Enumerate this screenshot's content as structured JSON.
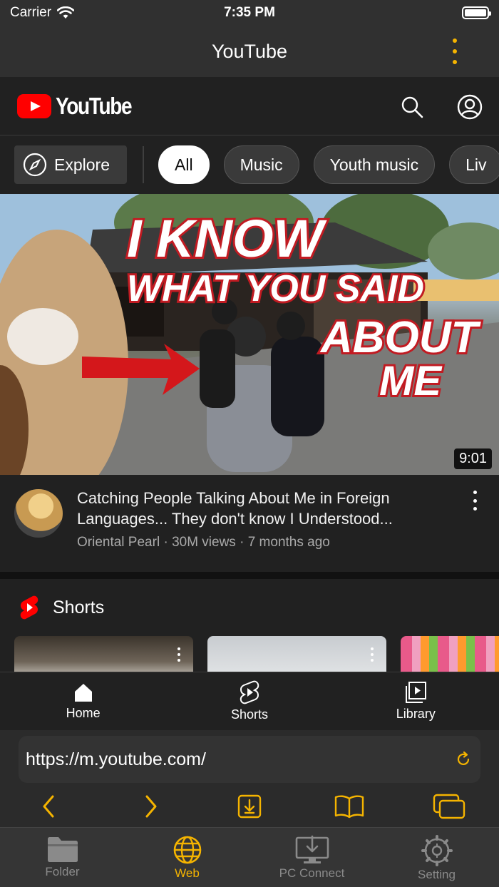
{
  "status_bar": {
    "carrier": "Carrier",
    "time": "7:35 PM"
  },
  "app_bar": {
    "title": "YouTube",
    "accent": "#f5b400"
  },
  "youtube": {
    "logo_text": "YouTube",
    "chips": {
      "explore": "Explore",
      "items": [
        "All",
        "Music",
        "Youth music",
        "Liv"
      ]
    },
    "video": {
      "thumb_text": [
        "I KNOW",
        "WHAT YOU SAID",
        "ABOUT",
        "ME"
      ],
      "duration": "9:01",
      "title": "Catching People Talking About Me in Foreign Languages... They don't know I Understood...",
      "channel": "Oriental Pearl",
      "views": "30M views",
      "age": "7 months ago"
    },
    "shorts_title": "Shorts",
    "nav": [
      "Home",
      "Shorts",
      "Library"
    ]
  },
  "browser": {
    "url": "https://m.youtube.com/"
  },
  "tabbar": {
    "items": [
      "Folder",
      "Web",
      "PC Connect",
      "Setting"
    ],
    "active": "Web"
  }
}
